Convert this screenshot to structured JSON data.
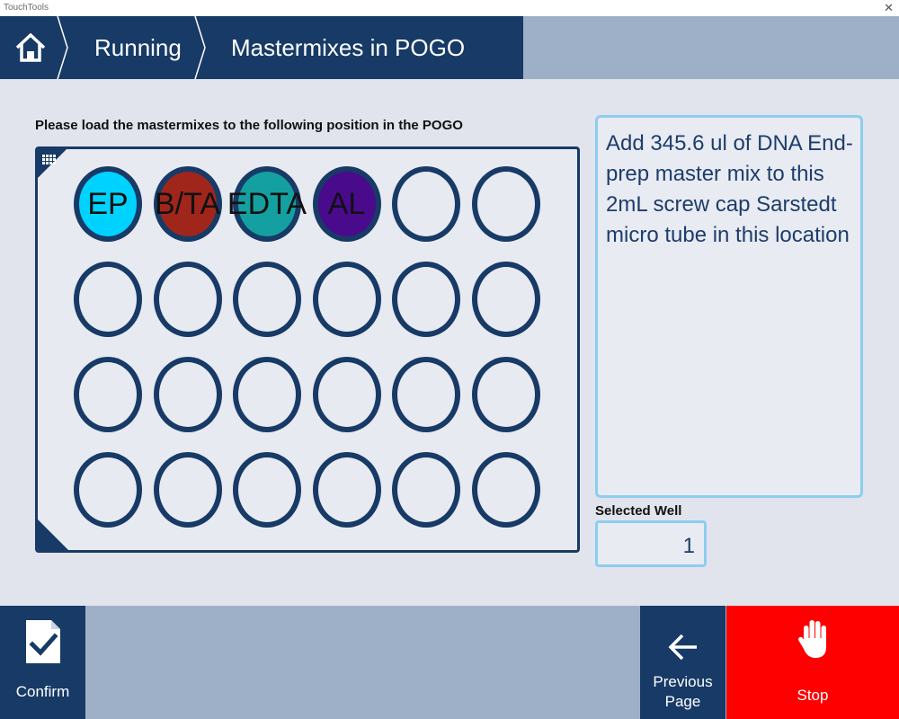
{
  "window": {
    "title": "TouchTools",
    "close_glyph": "✕"
  },
  "header": {
    "home_icon": "home-icon",
    "breadcrumbs": [
      "Running",
      "Mastermixes in POGO"
    ]
  },
  "main": {
    "instruction": "Please load the mastermixes to the following position in the POGO",
    "plate": {
      "rows": 4,
      "cols": 6,
      "wells": [
        {
          "label": "EP",
          "color": "#00d2ff"
        },
        {
          "label": "B/TA",
          "color": "#a0261b"
        },
        {
          "label": "EDTA",
          "color": "#14a0a0"
        },
        {
          "label": "AL",
          "color": "#4a0a8c"
        },
        {
          "label": "",
          "color": ""
        },
        {
          "label": "",
          "color": ""
        },
        {
          "label": "",
          "color": ""
        },
        {
          "label": "",
          "color": ""
        },
        {
          "label": "",
          "color": ""
        },
        {
          "label": "",
          "color": ""
        },
        {
          "label": "",
          "color": ""
        },
        {
          "label": "",
          "color": ""
        },
        {
          "label": "",
          "color": ""
        },
        {
          "label": "",
          "color": ""
        },
        {
          "label": "",
          "color": ""
        },
        {
          "label": "",
          "color": ""
        },
        {
          "label": "",
          "color": ""
        },
        {
          "label": "",
          "color": ""
        },
        {
          "label": "",
          "color": ""
        },
        {
          "label": "",
          "color": ""
        },
        {
          "label": "",
          "color": ""
        },
        {
          "label": "",
          "color": ""
        },
        {
          "label": "",
          "color": ""
        },
        {
          "label": "",
          "color": ""
        }
      ]
    },
    "info_text": "Add 345.6 ul of DNA End-prep master mix to this 2mL screw cap Sarstedt micro tube in this location",
    "selected_well_label": "Selected Well",
    "selected_well_value": "1"
  },
  "footer": {
    "confirm_label": "Confirm",
    "previous_label_line1": "Previous",
    "previous_label_line2": "Page",
    "stop_label": "Stop"
  },
  "colors": {
    "navy": "#173a66",
    "steel": "#9eb0c7",
    "accent_border": "#8ecdf0",
    "stop_red": "#ff0000"
  }
}
